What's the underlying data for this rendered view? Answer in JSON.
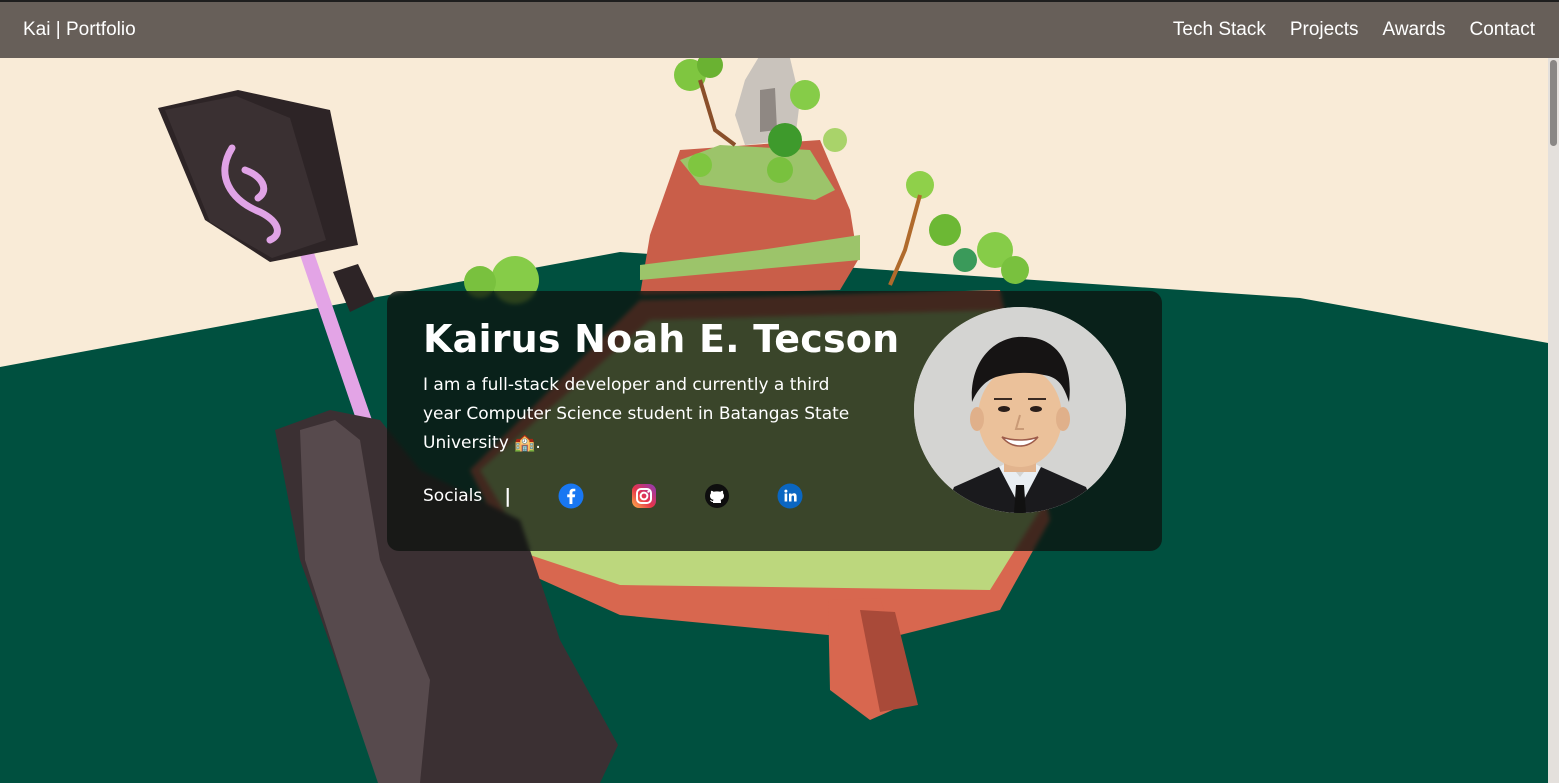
{
  "navbar": {
    "brand": "Kai | Portfolio",
    "links": [
      {
        "label": "Tech Stack"
      },
      {
        "label": "Projects"
      },
      {
        "label": "Awards"
      },
      {
        "label": "Contact"
      }
    ]
  },
  "hero": {
    "name": "Kairus Noah E. Tecson",
    "bio": "I am a full-stack developer and currently a third year Computer Science student in Batangas State University 🏫.",
    "socials_label": "Socials",
    "socials_separator": "|",
    "socials": [
      {
        "icon": "facebook-icon",
        "color": "#1877f2"
      },
      {
        "icon": "instagram-icon",
        "color": "#d6249f"
      },
      {
        "icon": "github-icon",
        "color": "#111111"
      },
      {
        "icon": "linkedin-icon",
        "color": "#0a66c2"
      }
    ]
  },
  "colors": {
    "sky": "#f9ebd7",
    "ground": "#00503f",
    "navbar": "#675f59",
    "card": "#0c120e"
  }
}
